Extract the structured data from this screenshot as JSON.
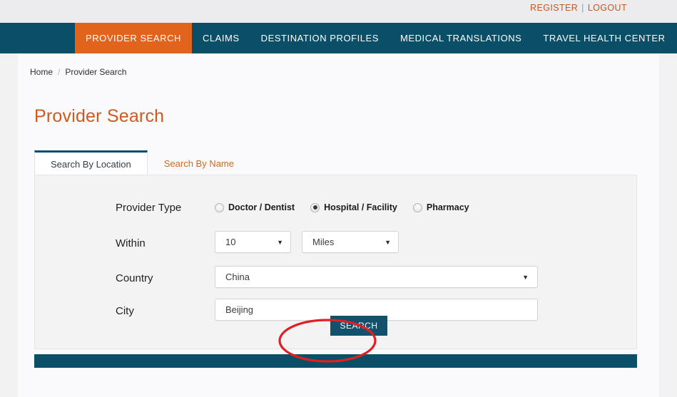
{
  "topbar": {
    "register_label": "REGISTER",
    "separator": "|",
    "logout_label": "LOGOUT"
  },
  "nav": {
    "items": [
      {
        "label": "PROVIDER SEARCH",
        "active": true
      },
      {
        "label": "CLAIMS",
        "active": false
      },
      {
        "label": "DESTINATION PROFILES",
        "active": false
      },
      {
        "label": "MEDICAL TRANSLATIONS",
        "active": false
      },
      {
        "label": "TRAVEL HEALTH CENTER",
        "active": false
      }
    ]
  },
  "breadcrumb": {
    "home_label": "Home",
    "separator": "/",
    "current_label": "Provider Search"
  },
  "page": {
    "title": "Provider Search"
  },
  "tabs": [
    {
      "label": "Search By Location",
      "active": true
    },
    {
      "label": "Search By Name",
      "active": false
    }
  ],
  "form": {
    "provider_type": {
      "label": "Provider Type",
      "options": [
        {
          "label": "Doctor / Dentist",
          "selected": false
        },
        {
          "label": "Hospital / Facility",
          "selected": true
        },
        {
          "label": "Pharmacy",
          "selected": false
        }
      ]
    },
    "within": {
      "label": "Within",
      "distance_value": "10",
      "unit_value": "Miles"
    },
    "country": {
      "label": "Country",
      "value": "China"
    },
    "city": {
      "label": "City",
      "value": "Beijing",
      "placeholder": "Beijing"
    },
    "search_button_label": "SEARCH"
  },
  "annotation": {
    "shape": "ellipse-highlight",
    "color": "#e02020",
    "target": "SEARCH"
  },
  "colors": {
    "nav_background": "#0b4e68",
    "active_tab_orange": "#e2631c",
    "title_orange": "#cf5a1e",
    "link_orange": "#c8561d",
    "button_teal": "#14506b",
    "annotation_red": "#e02020"
  },
  "icons": {
    "caret": "▼"
  }
}
